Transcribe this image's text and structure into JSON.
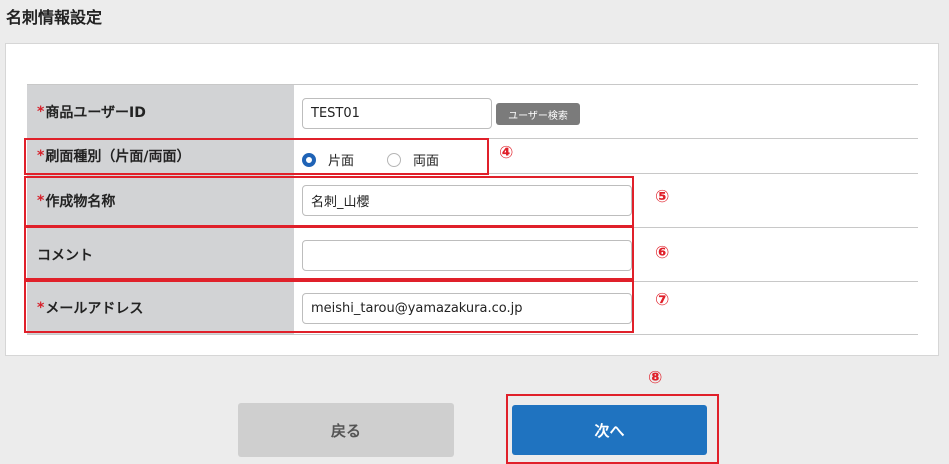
{
  "page_title": "名刺情報設定",
  "required_mark": "*",
  "form": {
    "product_user_id": {
      "label": "商品ユーザーID",
      "value": "TEST01",
      "search_button": "ユーザー検索"
    },
    "print_type": {
      "label": "刷面種別（片面/両面）",
      "options": [
        "片面",
        "両面"
      ],
      "selected": "片面"
    },
    "product_name": {
      "label": "作成物名称",
      "value": "名刺_山櫻"
    },
    "comment": {
      "label": "コメント",
      "value": ""
    },
    "email": {
      "label": "メールアドレス",
      "value": "meishi_tarou@yamazakura.co.jp"
    }
  },
  "buttons": {
    "back": "戻る",
    "next": "次へ"
  },
  "annotations": [
    "④",
    "⑤",
    "⑥",
    "⑦",
    "⑧"
  ],
  "colors": {
    "annotation": "#e0202a",
    "primary": "#1f73c0",
    "label_bg": "#d2d3d5"
  }
}
